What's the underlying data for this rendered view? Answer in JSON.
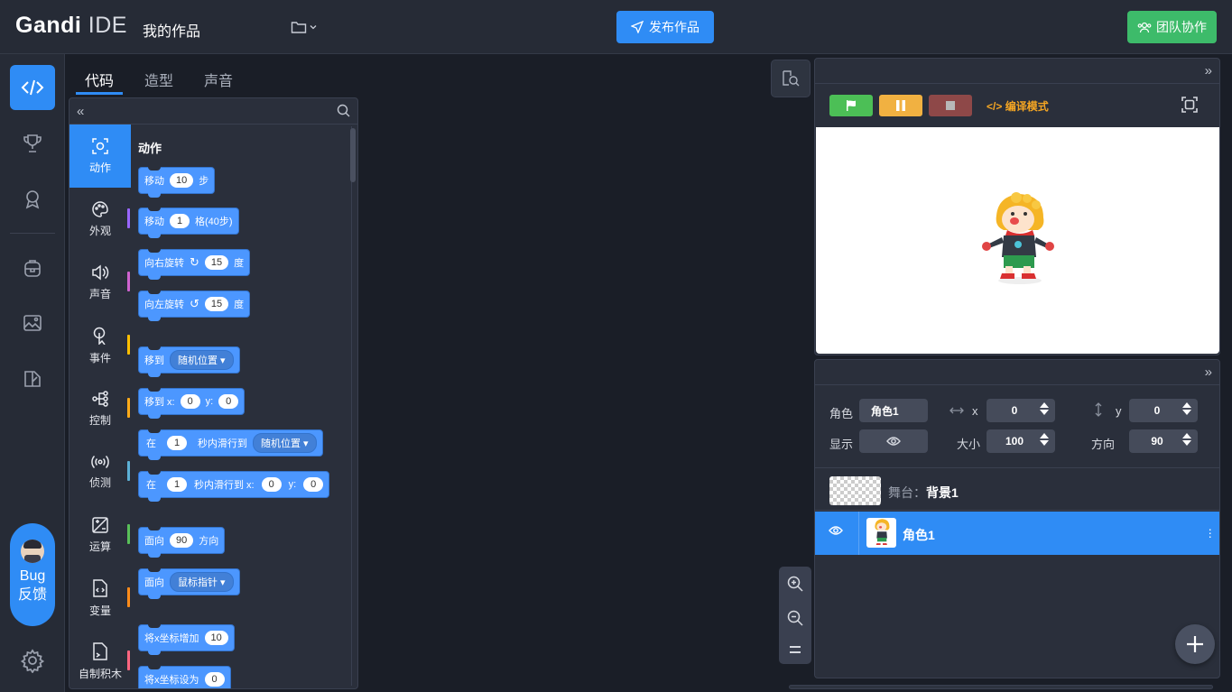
{
  "header": {
    "logo_bold": "Gandi",
    "logo_light": "IDE",
    "project_title": "我的作品",
    "publish_label": "发布作品",
    "team_label": "团队协作"
  },
  "rail": {
    "bug_line1": "Bug",
    "bug_line2": "反馈"
  },
  "tabs": [
    "代码",
    "造型",
    "声音"
  ],
  "categories": [
    {
      "label": "动作",
      "color": "#4c97ff"
    },
    {
      "label": "外观",
      "color": "#9966ff"
    },
    {
      "label": "声音",
      "color": "#cf63cf"
    },
    {
      "label": "事件",
      "color": "#ffbf00"
    },
    {
      "label": "控制",
      "color": "#ffab19"
    },
    {
      "label": "侦测",
      "color": "#5cb1d6"
    },
    {
      "label": "运算",
      "color": "#59c059"
    },
    {
      "label": "变量",
      "color": "#ff8c1a"
    },
    {
      "label": "自制积木",
      "color": "#ff6680"
    }
  ],
  "blocks": {
    "title": "动作",
    "move": {
      "label": "移动",
      "value": "10",
      "unit": "步"
    },
    "move_grid": {
      "label": "移动",
      "value": "1",
      "unit": "格(40步)"
    },
    "turn_right": {
      "label": "向右旋转",
      "value": "15",
      "unit": "度"
    },
    "turn_left": {
      "label": "向左旋转",
      "value": "15",
      "unit": "度"
    },
    "goto": {
      "label": "移到",
      "option": "随机位置"
    },
    "goto_xy": {
      "label": "移到 x:",
      "x": "0",
      "ylabel": "y:",
      "y": "0"
    },
    "glide": {
      "prefix": "在",
      "secs": "1",
      "label": "秒内滑行到",
      "option": "随机位置"
    },
    "glide_xy": {
      "prefix": "在",
      "secs": "1",
      "label": "秒内滑行到 x:",
      "x": "0",
      "ylabel": "y:",
      "y": "0"
    },
    "point_dir": {
      "label": "面向",
      "value": "90",
      "unit": "方向"
    },
    "point_towards": {
      "label": "面向",
      "option": "鼠标指针"
    },
    "change_x": {
      "label": "将x坐标增加",
      "value": "10"
    },
    "set_x": {
      "label": "将x坐标设为",
      "value": "0"
    }
  },
  "stage": {
    "compile_label": "编译模式"
  },
  "sprite_props": {
    "sprite_label": "角色",
    "sprite_name": "角色1",
    "x_label": "x",
    "x_value": "0",
    "y_label": "y",
    "y_value": "0",
    "show_label": "显示",
    "size_label": "大小",
    "size_value": "100",
    "dir_label": "方向",
    "dir_value": "90"
  },
  "sprite_list": {
    "stage_prefix": "舞台：",
    "stage_name": "背景1",
    "sprite_name": "角色1"
  },
  "colors": {
    "accent": "#2f8cf5",
    "green": "#3dbb6a",
    "motion": "#4c97ff"
  }
}
